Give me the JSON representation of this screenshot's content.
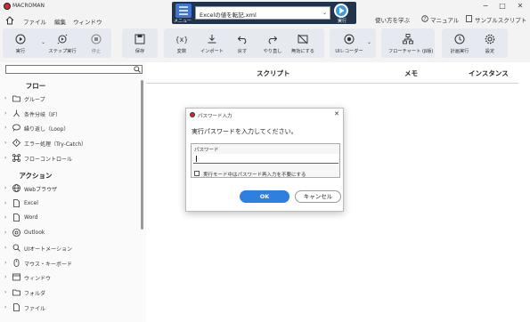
{
  "app": {
    "title": "MACROMAN",
    "accent": "#2d7fe0",
    "brand_red": "#d7282f"
  },
  "menu": {
    "items": [
      "ファイル",
      "編集",
      "ウィンドウ"
    ]
  },
  "runbox": {
    "menu_label": "メニュー",
    "selected_script": "Excelの値を転記.xml",
    "run_label": "実行"
  },
  "top_links": {
    "learn": "使い方を学ぶ",
    "manual": "マニュアル",
    "samples": "サンプルスクリプト"
  },
  "toolbar": {
    "run": "実行",
    "step_run": "ステップ実行",
    "stop": "停止",
    "save": "保存",
    "variable": "変数",
    "import": "インポート",
    "undo": "戻す",
    "redo": "やり直し",
    "disable": "無効にする",
    "ui_recorder": "UIレコーダー",
    "flowchart": "フローチャート (β版)",
    "schedule": "計画実行",
    "settings": "設定"
  },
  "sidebar": {
    "search_placeholder": "",
    "flow_title": "フロー",
    "flow_items": [
      {
        "label": "グループ",
        "icon": "folder-icon"
      },
      {
        "label": "条件分岐（IF）",
        "icon": "branch-icon"
      },
      {
        "label": "繰り返し（Loop）",
        "icon": "loop-icon"
      },
      {
        "label": "エラー処理（Try-Catch）",
        "icon": "error-icon"
      },
      {
        "label": "フローコントロール",
        "icon": "command-icon"
      }
    ],
    "action_title": "アクション",
    "action_items": [
      {
        "label": "Webブラウザ",
        "icon": "globe-icon"
      },
      {
        "label": "Excel",
        "icon": "file-icon"
      },
      {
        "label": "Word",
        "icon": "file-icon"
      },
      {
        "label": "Outlook",
        "icon": "mail-icon"
      },
      {
        "label": "UIオートメーション",
        "icon": "search-icon"
      },
      {
        "label": "マウス・キーボード",
        "icon": "mouse-icon"
      },
      {
        "label": "ウィンドウ",
        "icon": "window-icon"
      },
      {
        "label": "フォルダ",
        "icon": "folder-icon"
      },
      {
        "label": "ファイル",
        "icon": "file-icon"
      }
    ]
  },
  "main": {
    "columns": [
      "スクリプト",
      "メモ",
      "インスタンス"
    ]
  },
  "dialog": {
    "title": "パスワード入力",
    "message": "実行パスワードを入力してください。",
    "password_label": "パスワード",
    "password_value": "",
    "checkbox_label": "実行モード中はパスワード再入力を不要にする",
    "ok_label": "OK",
    "cancel_label": "キャンセル"
  }
}
